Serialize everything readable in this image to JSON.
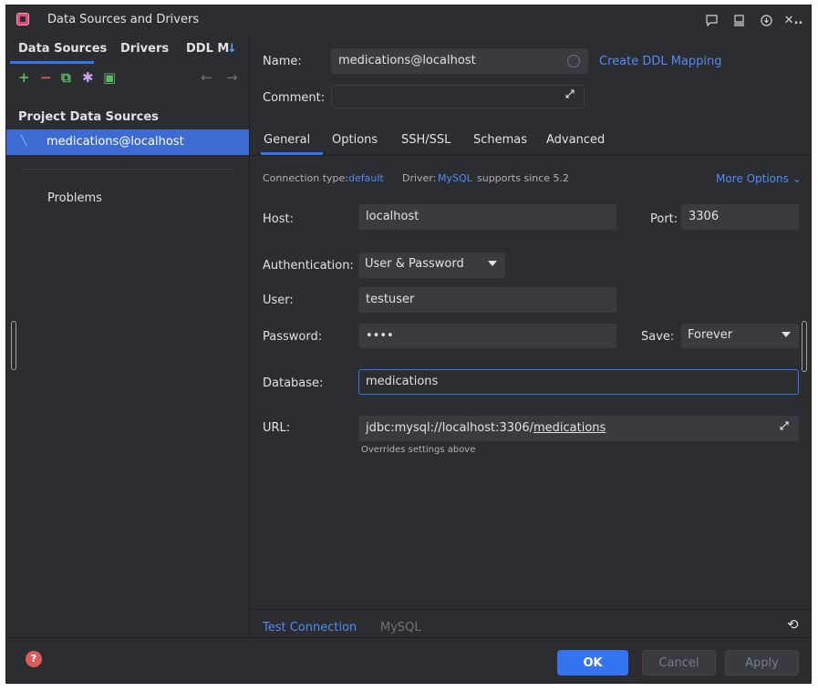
{
  "window": {
    "title": "Data Sources and Drivers"
  },
  "titlebar": {
    "icons": [
      "comment-icon",
      "presentation-icon",
      "download-icon",
      "close-icon"
    ]
  },
  "left": {
    "tabs": [
      {
        "label": "Data Sources"
      },
      {
        "label": "Drivers"
      },
      {
        "label": "DDL M"
      }
    ],
    "toolbar": {
      "icons": [
        "add-icon",
        "remove-icon",
        "copy-icon",
        "settings-icon",
        "import-icon",
        "back-icon",
        "forward-icon"
      ]
    },
    "section_title": "Project Data Sources",
    "items": [
      {
        "label": "medications@localhost"
      }
    ],
    "problems_label": "Problems"
  },
  "form": {
    "name_label": "Name:",
    "name_value": "medications@localhost",
    "create_ddl_link": "Create DDL Mapping",
    "comment_label": "Comment:",
    "comment_value": ""
  },
  "tabs": [
    {
      "label": "General"
    },
    {
      "label": "Options"
    },
    {
      "label": "SSH/SSL"
    },
    {
      "label": "Schemas"
    },
    {
      "label": "Advanced"
    }
  ],
  "general": {
    "connection_type_label": "Connection type:",
    "connection_type_value": "default",
    "driver_label": "Driver:",
    "driver_value": "MySQL",
    "driver_suffix": "supports since 5.2",
    "more_options": "More Options",
    "host_label": "Host:",
    "host_value": "localhost",
    "port_label": "Port:",
    "port_value": "3306",
    "auth_label": "Authentication:",
    "auth_value": "User & Password",
    "user_label": "User:",
    "user_value": "testuser",
    "password_label": "Password:",
    "password_value": "••••",
    "save_label": "Save:",
    "save_value": "Forever",
    "database_label": "Database:",
    "database_value": "medications",
    "url_label": "URL:",
    "url_prefix": "jdbc:mysql://localhost:3306/",
    "url_db": "medications",
    "url_hint": "Overrides settings above"
  },
  "bottom": {
    "test_connection": "Test Connection",
    "driver_name": "MySQL"
  },
  "footer": {
    "ok": "OK",
    "cancel": "Cancel",
    "apply": "Apply"
  },
  "colors": {
    "accent": "#3574f0",
    "selection": "#3d6bd3",
    "link": "#548af7",
    "background": "#2b2d30"
  }
}
